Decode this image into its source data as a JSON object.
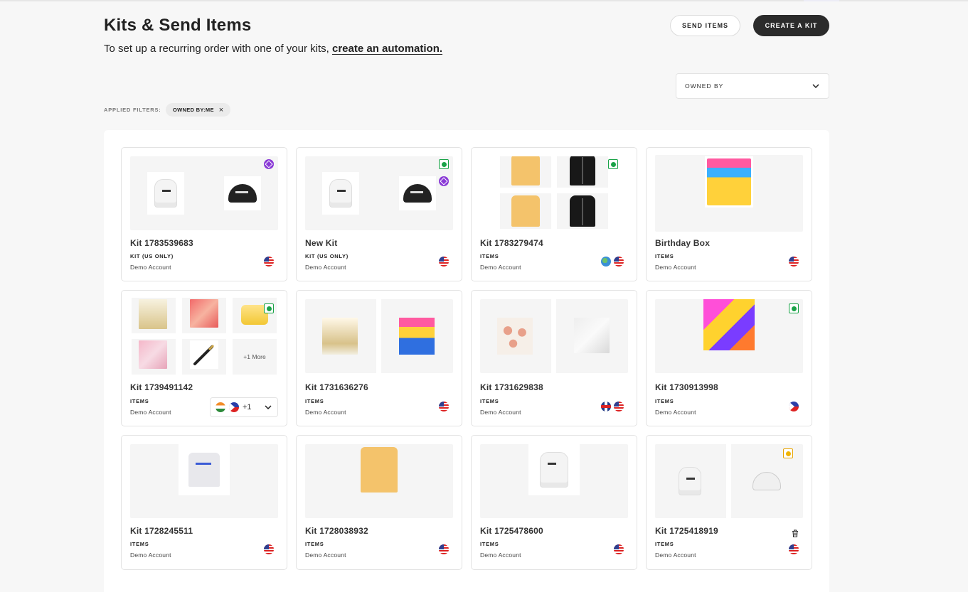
{
  "page": {
    "title": "Kits & Send Items",
    "subtitle_prefix": "To set up a recurring order with one of your kits,",
    "subtitle_link": "create an automation."
  },
  "header": {
    "send_items_label": "SEND ITEMS",
    "create_kit_label": "CREATE A KIT"
  },
  "filters": {
    "owned_by_placeholder": "OWNED BY",
    "applied_label": "APPLIED FILTERS:",
    "chips": [
      "OWNED BY:ME"
    ]
  },
  "kits": [
    {
      "name": "Kit 1783539683",
      "type": "KIT (US ONLY)",
      "owner": "Demo Account",
      "flags": [
        "us"
      ],
      "badge": "purple",
      "images": [
        "hoodie-white",
        "cap-black"
      ]
    },
    {
      "name": "New Kit",
      "type": "KIT (US ONLY)",
      "owner": "Demo Account",
      "flags": [
        "us"
      ],
      "badges": [
        "green",
        "purple"
      ],
      "images": [
        "hoodie-white",
        "cap-black"
      ]
    },
    {
      "name": "Kit 1783279474",
      "type": "ITEMS",
      "owner": "Demo Account",
      "flags": [
        "world",
        "us"
      ],
      "badge": "green",
      "images": [
        "tee-yellow",
        "jacket-black",
        "tee-yellow",
        "jacket-black"
      ]
    },
    {
      "name": "Birthday Box",
      "type": "ITEMS",
      "owner": "Demo Account",
      "flags": [
        "us"
      ],
      "images": [
        "gift-box"
      ]
    },
    {
      "name": "Kit 1739491142",
      "type": "ITEMS",
      "owner": "Demo Account",
      "flags": [
        "in",
        "ph"
      ],
      "extra_flags": "+1",
      "badge": "green",
      "more_label": "+1 More",
      "images": [
        "perfume",
        "candy",
        "soap",
        "jewelry",
        "pen"
      ]
    },
    {
      "name": "Kit 1731636276",
      "type": "ITEMS",
      "owner": "Demo Account",
      "flags": [
        "us"
      ],
      "images": [
        "perfume",
        "snack-box"
      ]
    },
    {
      "name": "Kit 1731629838",
      "type": "ITEMS",
      "owner": "Demo Account",
      "flags": [
        "uk",
        "us"
      ],
      "images": [
        "cupcakes",
        "box-white"
      ]
    },
    {
      "name": "Kit 1730913998",
      "type": "ITEMS",
      "owner": "Demo Account",
      "flags": [
        "ph"
      ],
      "badge": "green",
      "images": [
        "snack-box"
      ]
    },
    {
      "name": "Kit 1728245511",
      "type": "ITEMS",
      "owner": "Demo Account",
      "flags": [
        "us"
      ],
      "images": [
        "tee-white"
      ]
    },
    {
      "name": "Kit 1728038932",
      "type": "ITEMS",
      "owner": "Demo Account",
      "flags": [
        "us"
      ],
      "images": [
        "tee-yellow"
      ]
    },
    {
      "name": "Kit 1725478600",
      "type": "ITEMS",
      "owner": "Demo Account",
      "flags": [
        "us"
      ],
      "images": [
        "hoodie-white"
      ]
    },
    {
      "name": "Kit 1725418919",
      "type": "ITEMS",
      "owner": "Demo Account",
      "flags": [
        "us"
      ],
      "badge": "yellow",
      "deletable": true,
      "images": [
        "hoodie-white",
        "cap-white"
      ]
    }
  ],
  "icons": {
    "dropdown": "chevron-down-icon",
    "remove_chip": "close-icon",
    "delete": "trash-icon"
  },
  "colors": {
    "primary_button": "#2b2b2b",
    "badge_green": "#1aa348",
    "badge_purple": "#8a3ad6",
    "badge_yellow": "#f0b400"
  }
}
